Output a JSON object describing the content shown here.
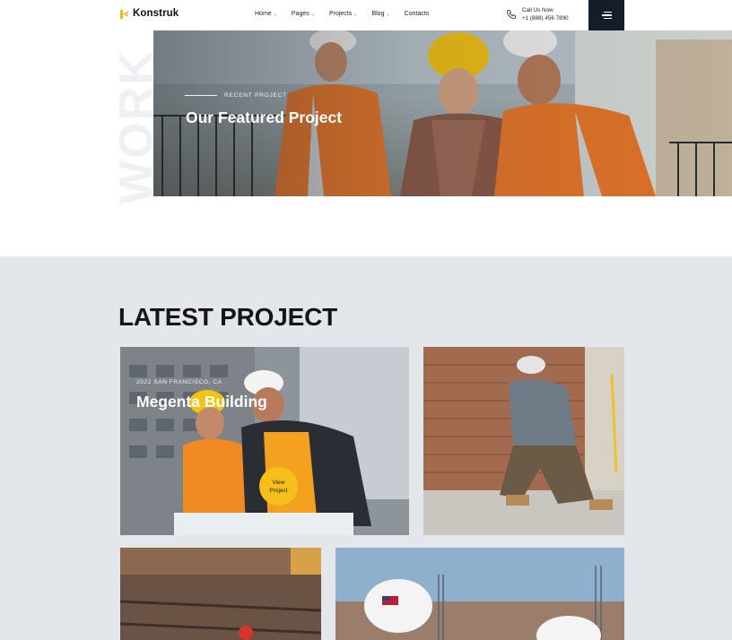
{
  "header": {
    "logo_text": "Konstruk",
    "nav": [
      {
        "label": "Home",
        "has_caret": true
      },
      {
        "label": "Pages",
        "has_caret": true
      },
      {
        "label": "Projects",
        "has_caret": true
      },
      {
        "label": "Blog",
        "has_caret": true
      },
      {
        "label": "Contacts",
        "has_caret": false
      }
    ],
    "call_label": "Call Us Now",
    "phone": "+1 (888) 456 7890",
    "menu_icon": "hamburger-icon",
    "phone_icon": "phone-icon"
  },
  "hero": {
    "watermark": "WORK",
    "eyebrow": "RECENT PROJECT",
    "title": "Our Featured Project"
  },
  "latest": {
    "title": "LATEST PROJECT",
    "featured": {
      "meta": "2022 SAN FRANCISCO, CA",
      "title": "Megenta Building",
      "button": "View Project"
    }
  },
  "colors": {
    "accent": "#f7bf1b",
    "dark": "#151c2a",
    "section_bg": "#e3e7ec"
  }
}
